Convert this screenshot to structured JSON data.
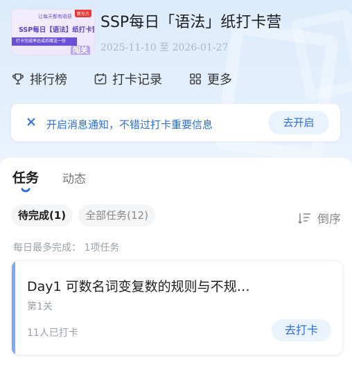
{
  "header": {
    "cover": {
      "line1": "让每天都有收获",
      "tag": "新东方",
      "line2": "SSP每日【语法】纸打卡营",
      "line3": "打卡完成率达成后赠送一份",
      "badge": "闯关"
    },
    "title": "SSP每日「语法」纸打卡营",
    "dates": "2025-11-10 至 2026-01-27"
  },
  "quick_nav": [
    {
      "label": "排行榜",
      "icon": "trophy-icon"
    },
    {
      "label": "打卡记录",
      "icon": "calendar-check-icon"
    },
    {
      "label": "更多",
      "icon": "grid-icon"
    }
  ],
  "notice": {
    "text": "开启消息通知，不错过打卡重要信息",
    "button": "去开启"
  },
  "tabs": {
    "active": "任务",
    "inactive": "动态"
  },
  "filters": {
    "pending": "待完成(1)",
    "all": "全部任务(12)",
    "sort": "倒序"
  },
  "daily_limit": "每日最多完成： 1项任务",
  "task": {
    "title": "Day1 可数名词变复数的规则与不规…",
    "level": "第1关",
    "count": "11人已打卡",
    "button": "去打卡"
  },
  "colors": {
    "accent": "#2a6fdb",
    "accent_bg": "#e9f2fd",
    "card_bar": "#7faaf0"
  }
}
